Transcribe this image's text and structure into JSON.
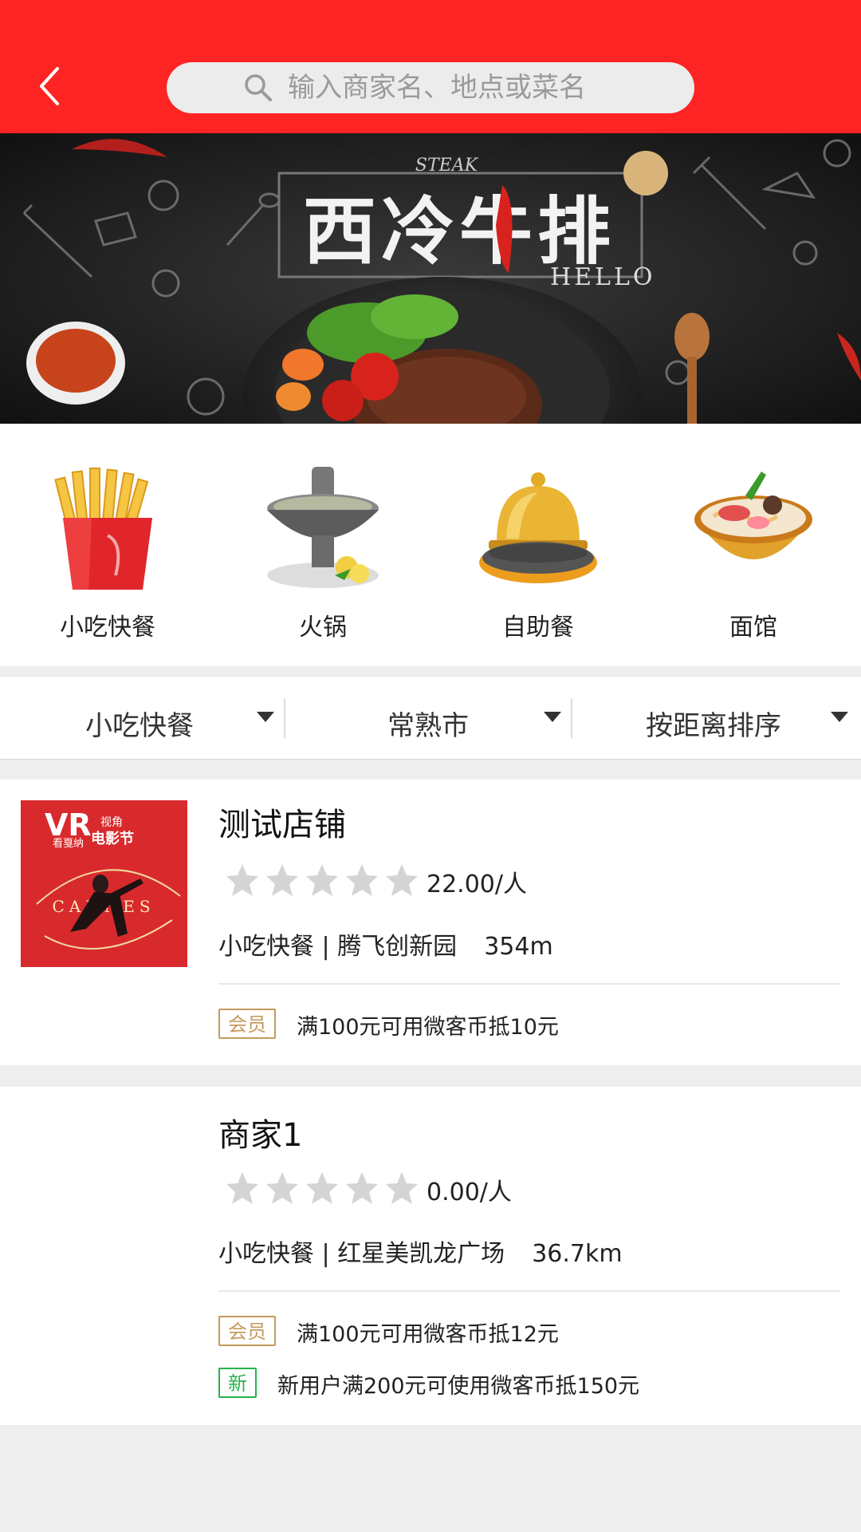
{
  "header": {
    "back_icon": "chevron-left-icon",
    "search": {
      "icon": "search-icon",
      "placeholder": "输入商家名、地点或菜名"
    }
  },
  "banner": {
    "title_text": "西冷牛排",
    "sub_text": "HELLO",
    "slides_count": 2,
    "active_slide": 2
  },
  "categories": [
    {
      "label": "小吃快餐",
      "icon": "fries-icon"
    },
    {
      "label": "火锅",
      "icon": "hotpot-icon"
    },
    {
      "label": "自助餐",
      "icon": "bell-icon"
    },
    {
      "label": "面馆",
      "icon": "noodle-bowl-icon"
    }
  ],
  "filters": [
    {
      "label": "小吃快餐"
    },
    {
      "label": "常熟市"
    },
    {
      "label": "按距离排序"
    }
  ],
  "listings": [
    {
      "name": "测试店铺",
      "rating": 0,
      "price": "22.00/人",
      "category": "小吃快餐",
      "location": "腾飞创新园",
      "distance": "354m",
      "thumbnail": {
        "brand": "VR",
        "brand_sub1": "视角",
        "brand_sub2": "看戛纳",
        "brand_sub3": "电影节",
        "word": "CANNES"
      },
      "promos": [
        {
          "badge": "会员",
          "type": "member",
          "text": "满100元可用微客币抵10元"
        }
      ]
    },
    {
      "name": "商家1",
      "rating": 0,
      "price": "0.00/人",
      "category": "小吃快餐",
      "location": "红星美凯龙广场",
      "distance": "36.7km",
      "promos": [
        {
          "badge": "会员",
          "type": "member",
          "text": "满100元可用微客币抵12元"
        },
        {
          "badge": "新",
          "type": "new",
          "text": "新用户满200元可使用微客币抵150元"
        }
      ]
    }
  ],
  "colors": {
    "header_red": "#fe2424",
    "member_gold": "#c49a5c",
    "new_green": "#27b34d",
    "star_gray": "#d4d4d4"
  }
}
